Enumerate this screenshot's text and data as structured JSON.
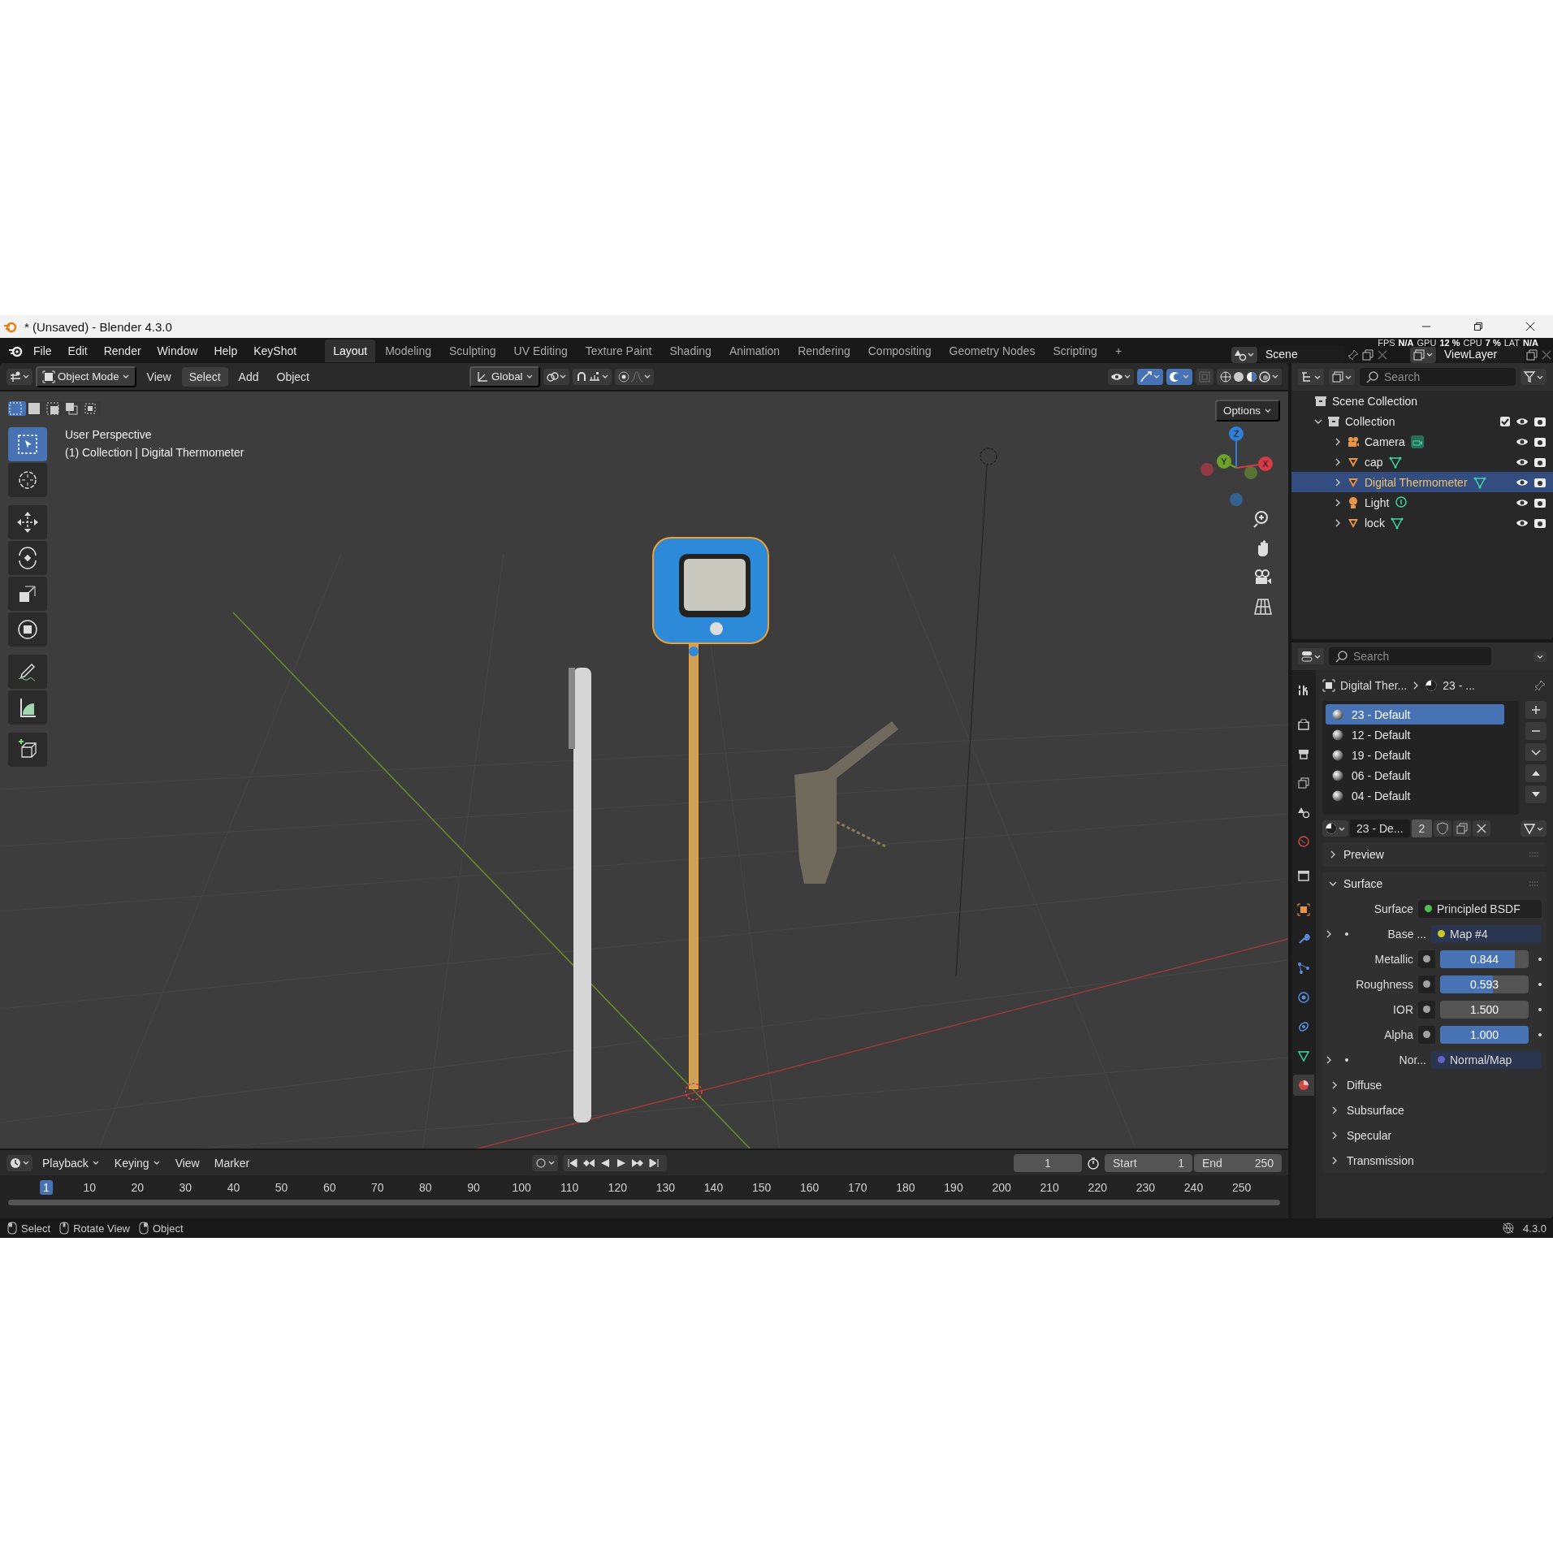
{
  "title_bar": {
    "title": "* (Unsaved) - Blender 4.3.0"
  },
  "menu_bar": {
    "menus": [
      "File",
      "Edit",
      "Render",
      "Window",
      "Help",
      "KeyShot"
    ],
    "workspaces": [
      {
        "label": "Layout",
        "selected": true
      },
      {
        "label": "Modeling",
        "selected": false
      },
      {
        "label": "Sculpting",
        "selected": false
      },
      {
        "label": "UV Editing",
        "selected": false
      },
      {
        "label": "Texture Paint",
        "selected": false
      },
      {
        "label": "Shading",
        "selected": false
      },
      {
        "label": "Animation",
        "selected": false
      },
      {
        "label": "Rendering",
        "selected": false
      },
      {
        "label": "Compositing",
        "selected": false
      },
      {
        "label": "Geometry Nodes",
        "selected": false
      },
      {
        "label": "Scripting",
        "selected": false
      }
    ],
    "add_workspace": "+",
    "scene": "Scene",
    "view_layer": "ViewLayer",
    "stats": [
      "FPS",
      "N/A",
      "GPU",
      "12 %",
      "CPU",
      "7 %",
      "LAT",
      "N/A"
    ]
  },
  "viewport_header": {
    "mode": "Object Mode",
    "menus": [
      {
        "label": "View",
        "selected": false
      },
      {
        "label": "Select",
        "selected": true
      },
      {
        "label": "Add",
        "selected": false
      },
      {
        "label": "Object",
        "selected": false
      }
    ],
    "orientation": "Global"
  },
  "viewport": {
    "options": "Options",
    "view_name": "User Perspective",
    "context": "(1) Collection | Digital Thermometer",
    "tools": [
      {
        "kind": "select",
        "selected": true
      },
      {
        "kind": "cursor",
        "selected": false
      },
      {
        "kind": "move",
        "selected": false
      },
      {
        "kind": "rotate",
        "selected": false
      },
      {
        "kind": "scale",
        "selected": false
      },
      {
        "kind": "transform",
        "selected": false
      },
      {
        "kind": "annotate",
        "selected": false
      },
      {
        "kind": "measure",
        "selected": false
      },
      {
        "kind": "add-cube",
        "selected": false
      }
    ],
    "axes": [
      {
        "label": "Z",
        "color": "#2f7fd6"
      },
      {
        "label": "Y",
        "color": "#6ea02c"
      },
      {
        "label": "X",
        "color": "#d63a48"
      }
    ]
  },
  "outliner": {
    "search_placeholder": "Search",
    "root": "Scene Collection",
    "collections": [
      {
        "label": "Collection",
        "expanded": true,
        "checked": true,
        "children": [
          {
            "label": "Camera",
            "kind": "camera",
            "selected": false
          },
          {
            "label": "cap",
            "kind": "mesh",
            "selected": false
          },
          {
            "label": "Digital Thermometer",
            "kind": "mesh",
            "selected": true
          },
          {
            "label": "Light",
            "kind": "light",
            "selected": false
          },
          {
            "label": "lock",
            "kind": "mesh",
            "selected": false
          }
        ]
      }
    ]
  },
  "properties": {
    "search_placeholder": "Search",
    "tabs": [
      {
        "kind": "tool",
        "selected": false
      },
      {
        "kind": "render",
        "selected": false
      },
      {
        "kind": "output",
        "selected": false
      },
      {
        "kind": "view_layer",
        "selected": false
      },
      {
        "kind": "scene",
        "selected": false
      },
      {
        "kind": "world",
        "selected": false
      },
      {
        "kind": "collection",
        "selected": false
      },
      {
        "kind": "object",
        "selected": false
      },
      {
        "kind": "modifier",
        "selected": false
      },
      {
        "kind": "particles",
        "selected": false
      },
      {
        "kind": "physics",
        "selected": false
      },
      {
        "kind": "constraints",
        "selected": false
      },
      {
        "kind": "data",
        "selected": false
      },
      {
        "kind": "material",
        "selected": true
      }
    ],
    "breadcrumb": [
      "Digital Ther...",
      "23 - ..."
    ],
    "slots": [
      {
        "label": "23 - Default",
        "selected": true
      },
      {
        "label": "12 - Default",
        "selected": false
      },
      {
        "label": "19 - Default",
        "selected": false
      },
      {
        "label": "06 - Default",
        "selected": false
      },
      {
        "label": "04 - Default",
        "selected": false
      }
    ],
    "material": {
      "name": "23 - De...",
      "users": "2"
    },
    "panels": [
      {
        "label": "Preview",
        "expanded": false
      },
      {
        "label": "Surface",
        "expanded": true,
        "rows": [
          {
            "kind": "shader",
            "label": "Surface",
            "value": "Principled BSDF",
            "color": "#4fbf4f"
          },
          {
            "kind": "link",
            "label": "Base ...",
            "value": "Map #4",
            "color": "#c7c729",
            "expanded": false
          },
          {
            "kind": "slider",
            "label": "Metallic",
            "value": "0.844",
            "level": 0.844,
            "color": "#a1a1a1"
          },
          {
            "kind": "slider",
            "label": "Roughness",
            "value": "0.593",
            "level": 0.593,
            "color": "#a1a1a1"
          },
          {
            "kind": "number",
            "label": "IOR",
            "value": "1.500",
            "color": "#a1a1a1"
          },
          {
            "kind": "slider",
            "label": "Alpha",
            "value": "1.000",
            "level": 1,
            "color": "#a1a1a1"
          },
          {
            "kind": "link",
            "label": "Nor...",
            "value": "Normal/Map",
            "color": "#6363c7",
            "expanded": false
          }
        ],
        "subpanels": [
          {
            "label": "Diffuse",
            "expanded": false
          },
          {
            "label": "Subsurface",
            "expanded": false
          },
          {
            "label": "Specular",
            "expanded": false
          },
          {
            "label": "Transmission",
            "expanded": false
          }
        ]
      }
    ]
  },
  "timeline": {
    "menus": [
      "Playback",
      "Keying",
      "View",
      "Marker"
    ],
    "current_frame": "1",
    "start_label": "Start",
    "start": "1",
    "end_label": "End",
    "end": "250",
    "ruler": [
      {
        "label": "1",
        "selected": true
      },
      {
        "label": "10",
        "selected": false
      },
      {
        "label": "20",
        "selected": false
      },
      {
        "label": "30",
        "selected": false
      },
      {
        "label": "40",
        "selected": false
      },
      {
        "label": "50",
        "selected": false
      },
      {
        "label": "60",
        "selected": false
      },
      {
        "label": "70",
        "selected": false
      },
      {
        "label": "80",
        "selected": false
      },
      {
        "label": "90",
        "selected": false
      },
      {
        "label": "100",
        "selected": false
      },
      {
        "label": "110",
        "selected": false
      },
      {
        "label": "120",
        "selected": false
      },
      {
        "label": "130",
        "selected": false
      },
      {
        "label": "140",
        "selected": false
      },
      {
        "label": "150",
        "selected": false
      },
      {
        "label": "160",
        "selected": false
      },
      {
        "label": "170",
        "selected": false
      },
      {
        "label": "180",
        "selected": false
      },
      {
        "label": "190",
        "selected": false
      },
      {
        "label": "200",
        "selected": false
      },
      {
        "label": "210",
        "selected": false
      },
      {
        "label": "220",
        "selected": false
      },
      {
        "label": "230",
        "selected": false
      },
      {
        "label": "240",
        "selected": false
      },
      {
        "label": "250",
        "selected": false
      }
    ]
  },
  "status_bar": {
    "hints": [
      "Select",
      "Rotate View",
      "Object"
    ],
    "version": "4.3.0"
  }
}
